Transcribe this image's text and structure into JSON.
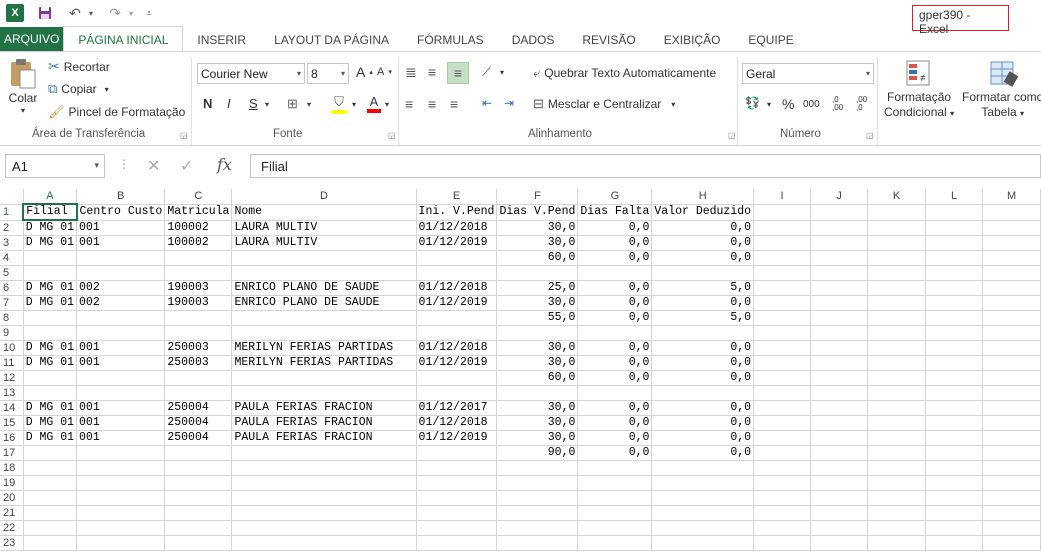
{
  "window": {
    "title": "gper390 - Excel"
  },
  "quick_access": {
    "app_icon": "X",
    "save_icon": "save-icon",
    "undo_icon": "undo-icon",
    "redo_icon": "redo-icon",
    "customize_icon": "customize-icon"
  },
  "tabs": [
    "ARQUIVO",
    "PÁGINA INICIAL",
    "INSERIR",
    "LAYOUT DA PÁGINA",
    "FÓRMULAS",
    "DADOS",
    "REVISÃO",
    "EXIBIÇÃO",
    "EQUIPE"
  ],
  "ribbon": {
    "clipboard": {
      "paste": "Colar",
      "cut": "Recortar",
      "copy": "Copiar",
      "painter": "Pincel de Formatação",
      "label": "Área de Transferência"
    },
    "font": {
      "name": "Courier New",
      "size": "8",
      "grow": "A",
      "shrink": "A",
      "bold": "N",
      "italic": "I",
      "underline": "S",
      "color_letter": "A",
      "label": "Fonte"
    },
    "alignment": {
      "wrap": "Quebrar Texto Automaticamente",
      "merge": "Mesclar e Centralizar",
      "label": "Alinhamento"
    },
    "number": {
      "format": "Geral",
      "percent": "%",
      "thousands": "000",
      "inc": ",0 ,00",
      "dec": ",00 ,0",
      "label": "Número"
    },
    "styles": {
      "cond_format_1": "Formatação",
      "cond_format_2": "Condicional",
      "as_table_1": "Formatar como",
      "as_table_2": "Tabela"
    }
  },
  "formula_bar": {
    "name_box": "A1",
    "cancel": "✕",
    "enter": "✓",
    "fx": "fx",
    "value": "Filial"
  },
  "colors": {
    "accent": "#217346",
    "title_border": "#e02020"
  },
  "columns": [
    "A",
    "B",
    "C",
    "D",
    "E",
    "F",
    "G",
    "H",
    "I",
    "J",
    "K",
    "L",
    "M"
  ],
  "rows": [
    [
      "Filial",
      "Centro Custo",
      "Matricula",
      "Nome",
      "Ini. V.Pend",
      "Dias V.Pend",
      "Dias Falta",
      "Valor Deduzido",
      "",
      "",
      "",
      "",
      ""
    ],
    [
      "D MG 01",
      "001",
      "100002",
      "LAURA MULTIV",
      "01/12/2018",
      "30,0",
      "0,0",
      "0,0",
      "",
      "",
      "",
      "",
      ""
    ],
    [
      "D MG 01",
      "001",
      "100002",
      "LAURA MULTIV",
      "01/12/2019",
      "30,0",
      "0,0",
      "0,0",
      "",
      "",
      "",
      "",
      ""
    ],
    [
      "",
      "",
      "",
      "",
      "",
      "60,0",
      "0,0",
      "0,0",
      "",
      "",
      "",
      "",
      ""
    ],
    [
      "",
      "",
      "",
      "",
      "",
      "",
      "",
      "",
      "",
      "",
      "",
      "",
      ""
    ],
    [
      "D MG 01",
      "002",
      "190003",
      "ENRICO PLANO DE SAUDE",
      "01/12/2018",
      "25,0",
      "0,0",
      "5,0",
      "",
      "",
      "",
      "",
      ""
    ],
    [
      "D MG 01",
      "002",
      "190003",
      "ENRICO PLANO DE SAUDE",
      "01/12/2019",
      "30,0",
      "0,0",
      "0,0",
      "",
      "",
      "",
      "",
      ""
    ],
    [
      "",
      "",
      "",
      "",
      "",
      "55,0",
      "0,0",
      "5,0",
      "",
      "",
      "",
      "",
      ""
    ],
    [
      "",
      "",
      "",
      "",
      "",
      "",
      "",
      "",
      "",
      "",
      "",
      "",
      ""
    ],
    [
      "D MG 01",
      "001",
      "250003",
      "MERILYN FERIAS PARTIDAS",
      "01/12/2018",
      "30,0",
      "0,0",
      "0,0",
      "",
      "",
      "",
      "",
      ""
    ],
    [
      "D MG 01",
      "001",
      "250003",
      "MERILYN FERIAS PARTIDAS",
      "01/12/2019",
      "30,0",
      "0,0",
      "0,0",
      "",
      "",
      "",
      "",
      ""
    ],
    [
      "",
      "",
      "",
      "",
      "",
      "60,0",
      "0,0",
      "0,0",
      "",
      "",
      "",
      "",
      ""
    ],
    [
      "",
      "",
      "",
      "",
      "",
      "",
      "",
      "",
      "",
      "",
      "",
      "",
      ""
    ],
    [
      "D MG 01",
      "001",
      "250004",
      "PAULA FERIAS FRACION",
      "01/12/2017",
      "30,0",
      "0,0",
      "0,0",
      "",
      "",
      "",
      "",
      ""
    ],
    [
      "D MG 01",
      "001",
      "250004",
      "PAULA FERIAS FRACION",
      "01/12/2018",
      "30,0",
      "0,0",
      "0,0",
      "",
      "",
      "",
      "",
      ""
    ],
    [
      "D MG 01",
      "001",
      "250004",
      "PAULA FERIAS FRACION",
      "01/12/2019",
      "30,0",
      "0,0",
      "0,0",
      "",
      "",
      "",
      "",
      ""
    ],
    [
      "",
      "",
      "",
      "",
      "",
      "90,0",
      "0,0",
      "0,0",
      "",
      "",
      "",
      "",
      ""
    ],
    [
      "",
      "",
      "",
      "",
      "",
      "",
      "",
      "",
      "",
      "",
      "",
      "",
      ""
    ],
    [
      "",
      "",
      "",
      "",
      "",
      "",
      "",
      "",
      "",
      "",
      "",
      "",
      ""
    ],
    [
      "",
      "",
      "",
      "",
      "",
      "",
      "",
      "",
      "",
      "",
      "",
      "",
      ""
    ],
    [
      "",
      "",
      "",
      "",
      "",
      "",
      "",
      "",
      "",
      "",
      "",
      "",
      ""
    ],
    [
      "",
      "",
      "",
      "",
      "",
      "",
      "",
      "",
      "",
      "",
      "",
      "",
      ""
    ],
    [
      "",
      "",
      "",
      "",
      "",
      "",
      "",
      "",
      "",
      "",
      "",
      "",
      ""
    ]
  ]
}
